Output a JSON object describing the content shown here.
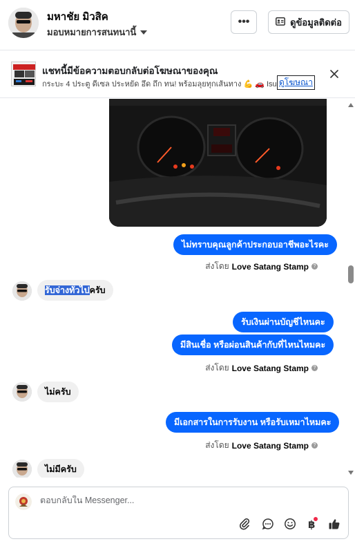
{
  "header": {
    "contact_name": "มหาชัย มิวสิค",
    "contact_sub": "มอบหมายการสนทนานี้",
    "more_label": "•••",
    "contact_info_label": "ดูข้อมูลติดต่อ"
  },
  "ad": {
    "title": "แชทนี้มีข้อความตอบกลับต่อโฆษณาของคุณ",
    "description": "กระบะ 4 ประตู ดีเซล ประหยัด อึด ถึก ทน! พร้อมลุยทุกเส้นทาง 💪 🚗 Isuz...",
    "view_ad_label": "ดูโฆษณา"
  },
  "messages": [
    {
      "type": "out",
      "text": "ไม่ทราบคุณลูกค้าประกอบอาชีพอะไรคะ"
    },
    {
      "type": "in_highlight",
      "highlight": "รับจ่างทั่วไป",
      "rest": "ครับ"
    },
    {
      "type": "out",
      "text": "รับเงินผ่านบัญชีไหนคะ"
    },
    {
      "type": "out",
      "text": "มีสินเชื่อ หรือผ่อนสินค้ากับที่ไหนไหมคะ"
    },
    {
      "type": "in",
      "text": "ไม่ครับ"
    },
    {
      "type": "out",
      "text": "มีเอกสารในการรับงาน หรือรับเหมาไหมคะ"
    },
    {
      "type": "in",
      "text": "ไม่มีครับ"
    }
  ],
  "sent_by": {
    "prefix": "ส่งโดย",
    "name": "Love Satang Stamp"
  },
  "composer": {
    "placeholder": "ตอบกลับใน Messenger..."
  },
  "colors": {
    "accent": "#0866ff",
    "incoming_bubble": "#f0f0f0",
    "selection": "#3367d6"
  },
  "icons": [
    "more-icon",
    "contact-card-icon",
    "close-icon",
    "attach-icon",
    "saved-reply-icon",
    "emoji-icon",
    "baht-icon",
    "like-icon"
  ]
}
